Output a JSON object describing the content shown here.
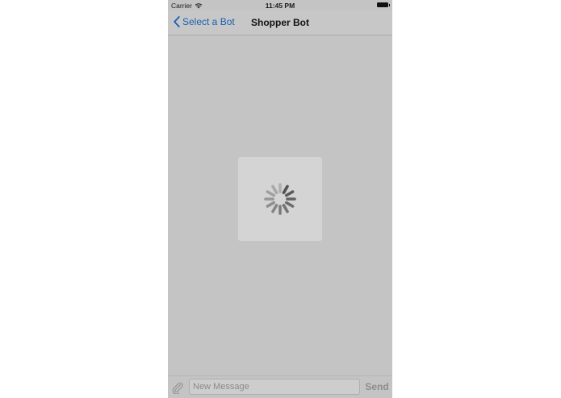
{
  "status_bar": {
    "carrier": "Carrier",
    "time": "11:45 PM",
    "icons": [
      "wifi-icon",
      "battery-icon"
    ]
  },
  "nav_bar": {
    "back_label": "Select a Bot",
    "back_icon": "chevron-left-icon",
    "title": "Shopper Bot"
  },
  "loading": {
    "icon": "spinner-icon"
  },
  "composer": {
    "attach_icon": "paperclip-icon",
    "placeholder": "New Message",
    "value": "",
    "send_label": "Send"
  },
  "colors": {
    "background": "#c4c4c4",
    "accent": "#1a5fb4",
    "send_disabled": "#8c8c8c"
  }
}
